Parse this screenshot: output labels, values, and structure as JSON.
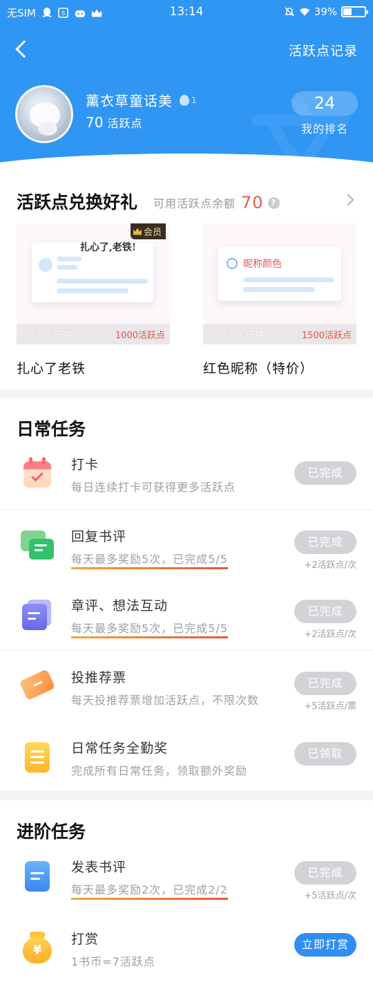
{
  "status_bar": {
    "carrier": "无SIM",
    "time": "13:14",
    "battery": "39%",
    "battery_level": 0.39,
    "left_icons": [
      "qq-icon",
      "s-app-icon",
      "tv-icon",
      "crown-icon"
    ],
    "right_icons": [
      "mute-icon",
      "wifi-icon",
      "battery-icon"
    ]
  },
  "nav": {
    "record_link": "活跃点记录"
  },
  "profile": {
    "name": "薰衣草童话美",
    "level": "1",
    "points": "70",
    "points_label": "活跃点",
    "rank": "24",
    "rank_label": "我的排名"
  },
  "gift": {
    "title": "活跃点兑换好礼",
    "balance_label": "可用活跃点余额",
    "balance": "70",
    "cards": [
      {
        "name": "扎心了老铁",
        "count": "4.4万人已换",
        "price": "1000活跃点",
        "badge": "会员",
        "slogan": "扎心了,老铁!"
      },
      {
        "name": "红色昵称（特价）",
        "count": "30.7万人已换",
        "price": "1500活跃点",
        "preview": "昵称颜色"
      }
    ]
  },
  "daily": {
    "title": "日常任务",
    "tasks": [
      {
        "title": "打卡",
        "desc": "每日连续打卡可获得更多活跃点",
        "button": "已完成",
        "reward": ""
      },
      {
        "title": "回复书评",
        "desc": "每天最多奖励5次，已完成5/5",
        "button": "已完成",
        "reward": "+2活跃点/次"
      },
      {
        "title": "章评、想法互动",
        "desc": "每天最多奖励5次，已完成5/5",
        "button": "已完成",
        "reward": "+2活跃点/次"
      },
      {
        "title": "投推荐票",
        "desc": "每天投推荐票增加活跃点，不限次数",
        "button": "已完成",
        "reward": "+5活跃点/票"
      },
      {
        "title": "日常任务全勤奖",
        "desc": "完成所有日常任务，领取额外奖励",
        "button": "已领取",
        "reward": ""
      }
    ]
  },
  "advanced": {
    "title": "进阶任务",
    "tasks": [
      {
        "title": "发表书评",
        "desc": "每天最多奖励2次，已完成2/2",
        "button": "已完成",
        "reward": "+5活跃点/次"
      },
      {
        "title": "打赏",
        "desc": "1书币=7活跃点",
        "button": "立即打赏",
        "reward": ""
      }
    ]
  },
  "colors": {
    "brand_blue": "#2f96f4",
    "accent_red": "#e85b4b",
    "button_done": "#d1d3d7",
    "button_active": "#2f8ef0"
  }
}
